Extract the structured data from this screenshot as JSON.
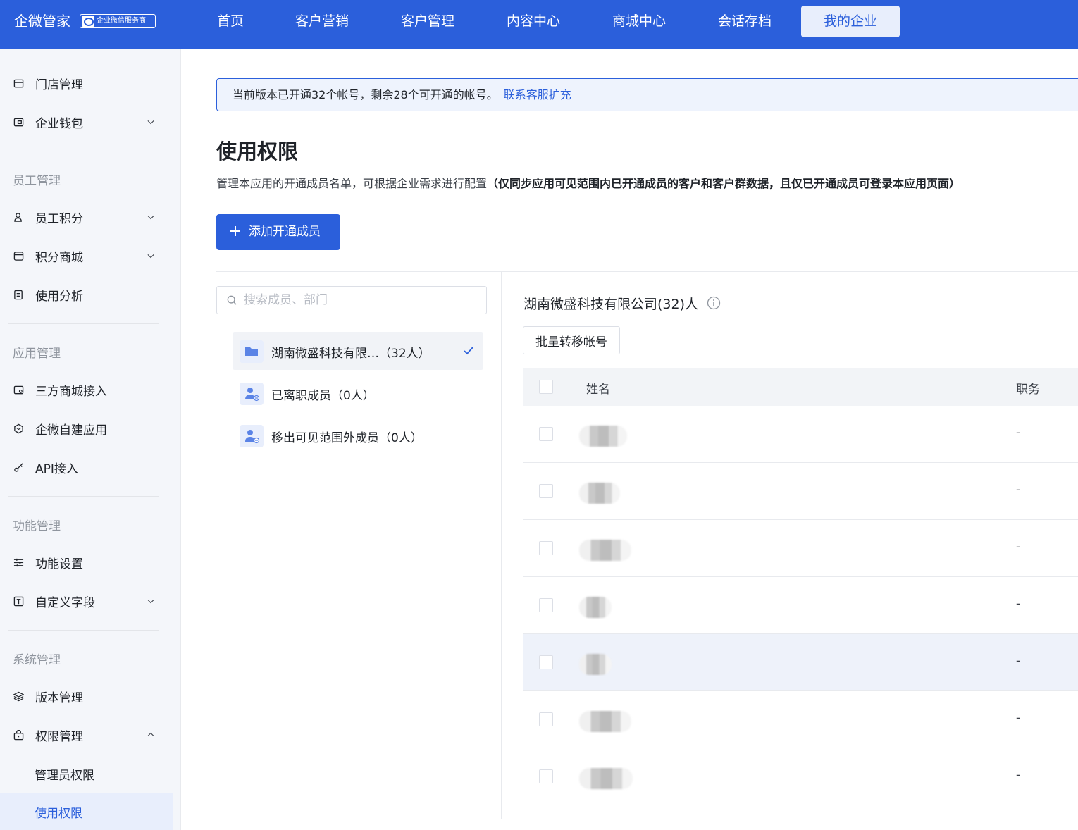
{
  "header": {
    "brand": "企微管家",
    "badge": "企业微信服务商",
    "nav": [
      "首页",
      "客户营销",
      "客户管理",
      "内容中心",
      "商城中心",
      "会话存档",
      "我的企业"
    ],
    "active_nav": "我的企业"
  },
  "sidebar": {
    "top_items": [
      {
        "label": "门店管理",
        "icon": "store-icon",
        "expandable": false
      },
      {
        "label": "企业钱包",
        "icon": "wallet-icon",
        "expandable": true
      }
    ],
    "groups": [
      {
        "title": "员工管理",
        "items": [
          {
            "label": "员工积分",
            "icon": "user-points-icon",
            "expandable": true
          },
          {
            "label": "积分商城",
            "icon": "points-mall-icon",
            "expandable": true
          },
          {
            "label": "使用分析",
            "icon": "analysis-icon",
            "expandable": false
          }
        ]
      },
      {
        "title": "应用管理",
        "items": [
          {
            "label": "三方商城接入",
            "icon": "mall-connect-icon",
            "expandable": false
          },
          {
            "label": "企微自建应用",
            "icon": "cube-icon",
            "expandable": false
          },
          {
            "label": "API接入",
            "icon": "key-icon",
            "expandable": false
          }
        ]
      },
      {
        "title": "功能管理",
        "items": [
          {
            "label": "功能设置",
            "icon": "sliders-icon",
            "expandable": false
          },
          {
            "label": "自定义字段",
            "icon": "text-field-icon",
            "expandable": true
          }
        ]
      },
      {
        "title": "系统管理",
        "items": [
          {
            "label": "版本管理",
            "icon": "layers-icon",
            "expandable": false
          },
          {
            "label": "权限管理",
            "icon": "lock-icon",
            "expandable": true,
            "expanded": true
          }
        ]
      }
    ],
    "sub_items": [
      "管理员权限",
      "使用权限"
    ],
    "active_sub": "使用权限"
  },
  "notice": {
    "text": "当前版本已开通32个帐号，剩余28个可开通的帐号。",
    "link": "联系客服扩充"
  },
  "page": {
    "title": "使用权限",
    "desc": "管理本应用的开通成员名单，可根据企业需求进行配置",
    "desc_bold": "（仅同步应用可见范围内已开通成员的客户和客户群数据，且仅已开通成员可登录本应用页面）",
    "add_button": "添加开通成员"
  },
  "tree": {
    "search_placeholder": "搜索成员、部门",
    "items": [
      {
        "label": "湖南微盛科技有限…（32人）",
        "icon": "folder-icon",
        "selected": true
      },
      {
        "label": "已离职成员（0人）",
        "icon": "user-off-icon",
        "selected": false
      },
      {
        "label": "移出可见范围外成员（0人）",
        "icon": "user-off-icon",
        "selected": false
      }
    ]
  },
  "members": {
    "org_title": "湖南微盛科技有限公司(32)人",
    "batch_button": "批量转移帐号",
    "columns": {
      "name": "姓名",
      "position": "职务"
    },
    "rows": [
      {
        "position": "-"
      },
      {
        "position": "-"
      },
      {
        "position": "-"
      },
      {
        "position": "-"
      },
      {
        "position": "-"
      },
      {
        "position": "-"
      },
      {
        "position": "-"
      }
    ]
  },
  "colors": {
    "primary": "#2b5fdb",
    "sidebar_bg": "#f4f6fa",
    "active_bg": "#e8eefc"
  }
}
